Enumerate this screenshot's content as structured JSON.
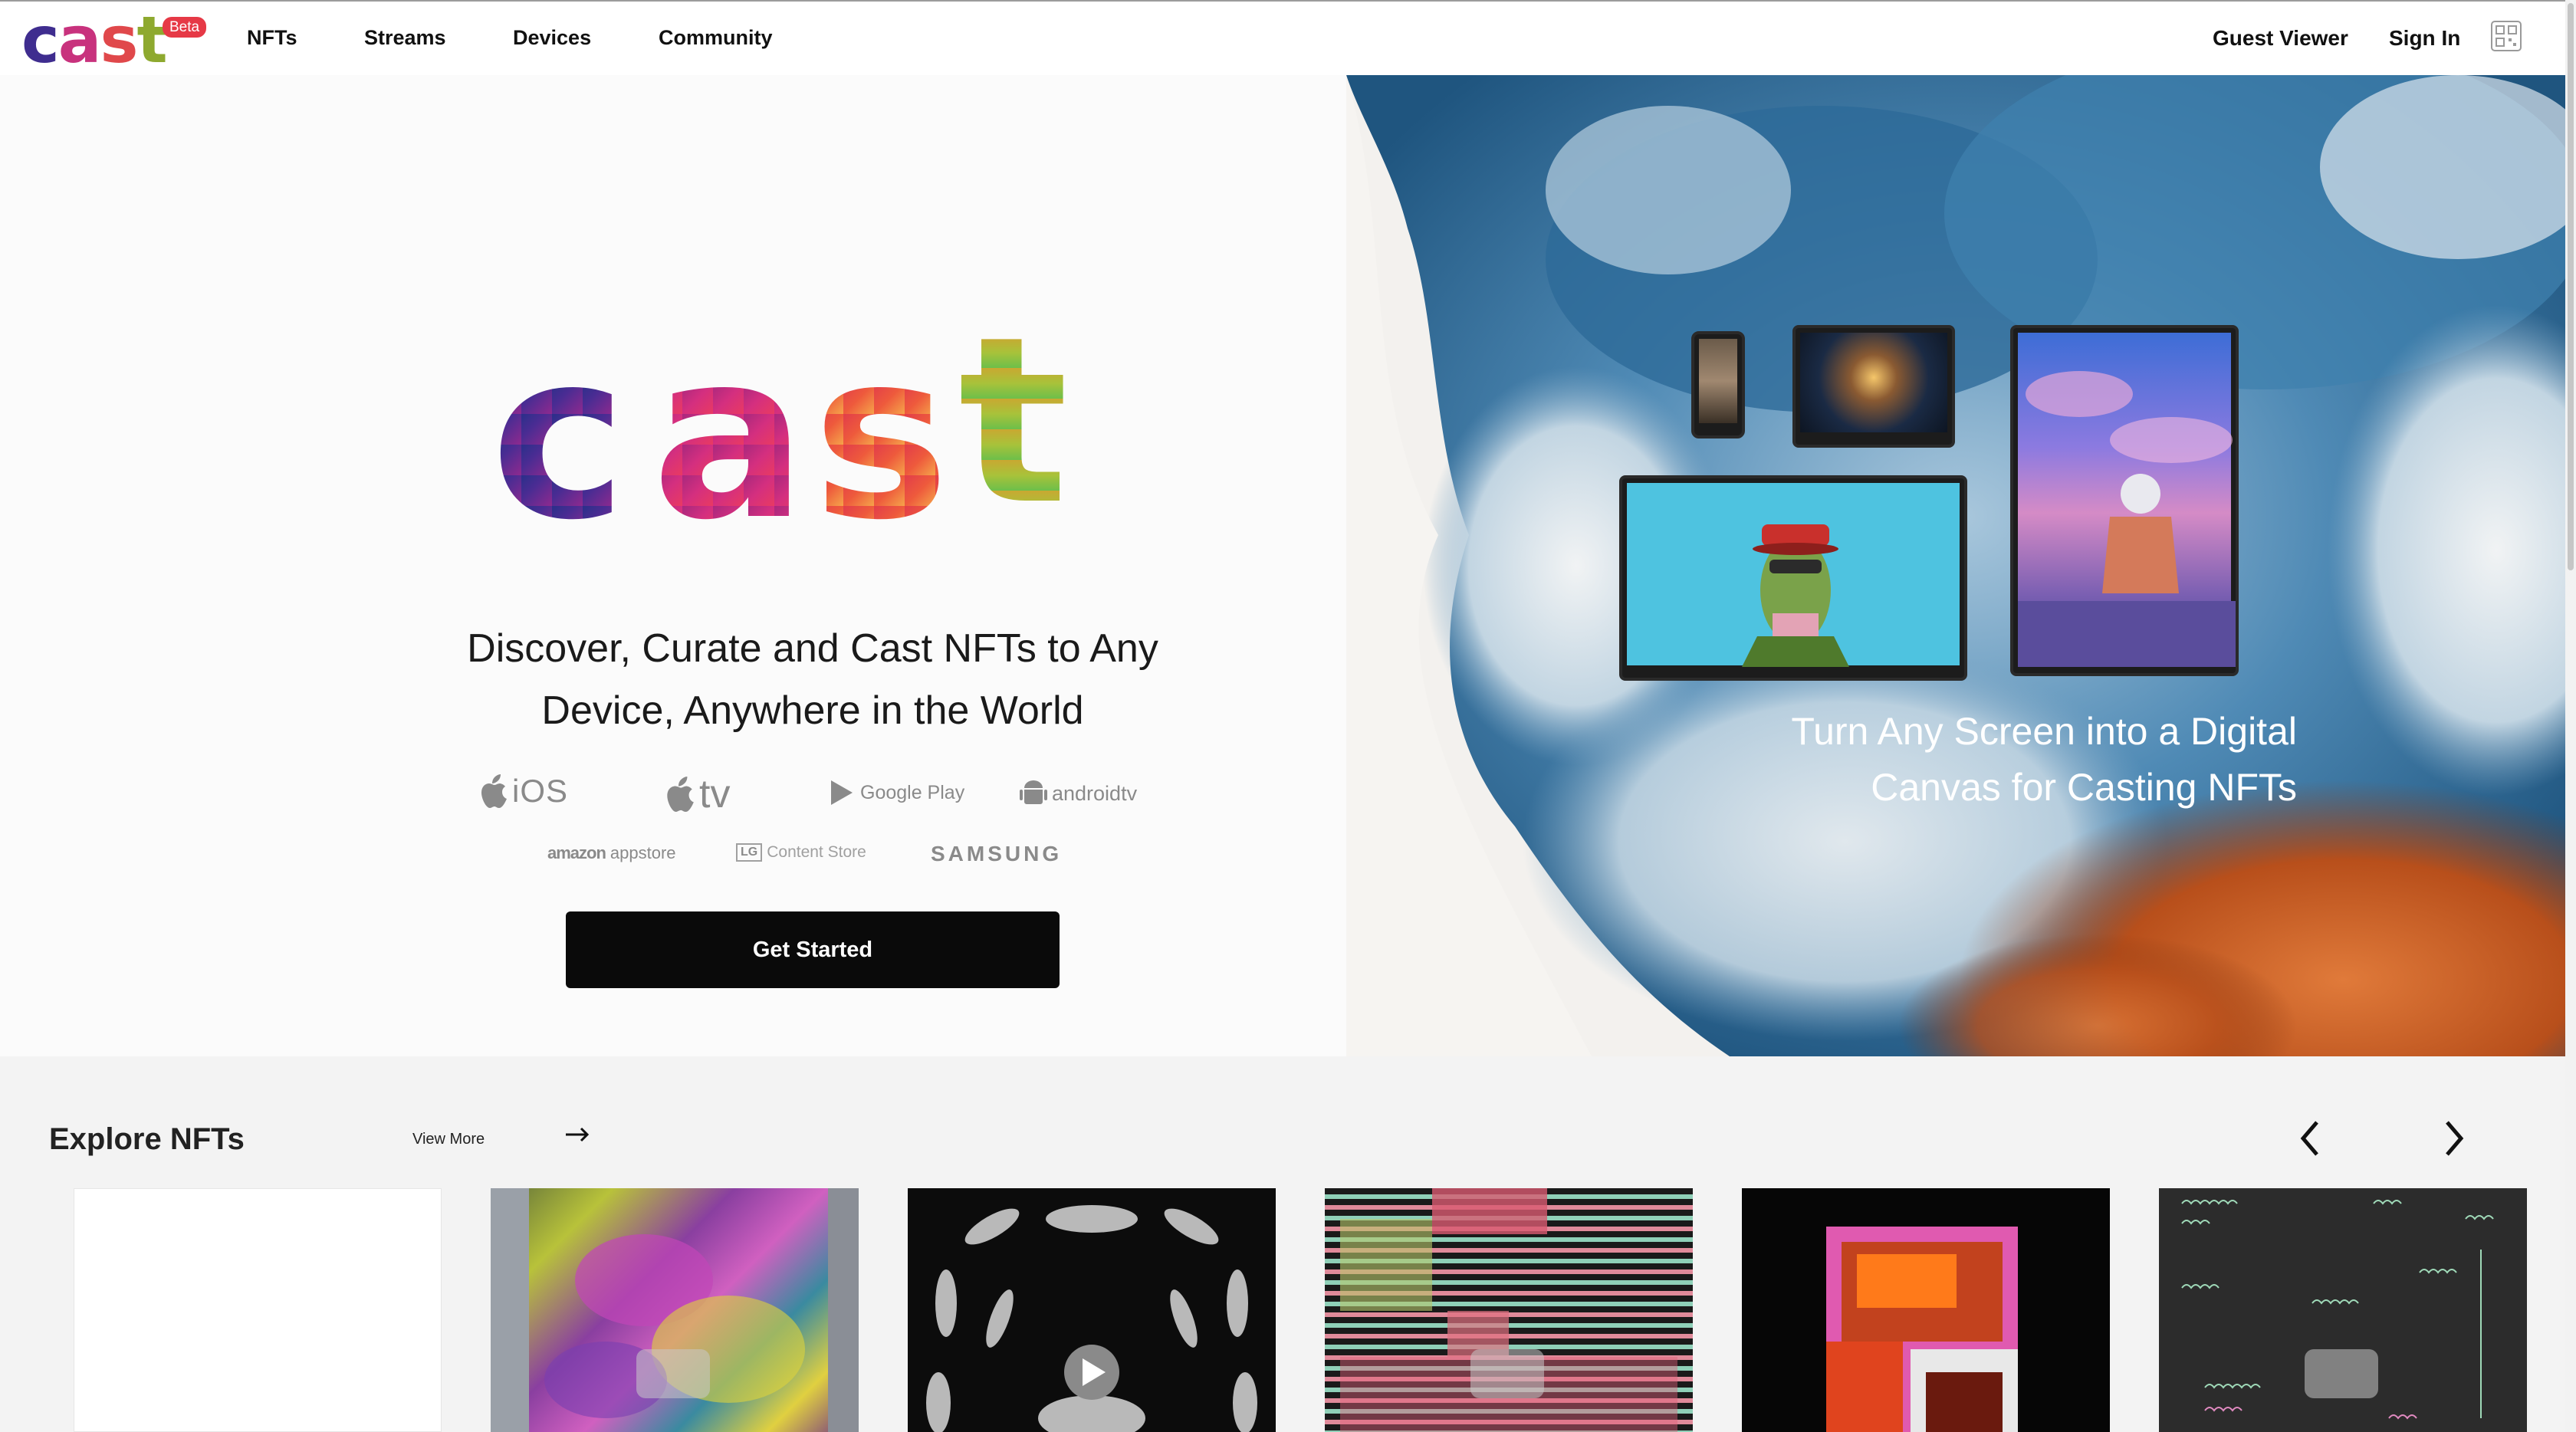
{
  "nav": {
    "logo": "cast",
    "beta": "Beta",
    "links": [
      "NFTs",
      "Streams",
      "Devices",
      "Community"
    ],
    "guest_viewer": "Guest Viewer",
    "sign_in": "Sign In",
    "qr_icon": "qr-code-icon"
  },
  "hero": {
    "logo": "cast",
    "tagline_line1": "Discover, Curate and Cast NFTs to Any",
    "tagline_line2": "Device, Anywhere in the World",
    "platforms": {
      "ios": "iOS",
      "tv": "tv",
      "google_play": "Google Play",
      "androidtv": "androidtv",
      "amazon": "amazon",
      "appstore": "appstore",
      "lg": "LG",
      "content_store": "Content Store",
      "samsung": "SAMSUNG"
    },
    "cta": "Get Started",
    "caption_line1": "Turn Any Screen into a Digital",
    "caption_line2": "Canvas for Casting NFTs",
    "device_brand": "cast"
  },
  "explore": {
    "title": "Explore NFTs",
    "view_more": "View More",
    "prev_icon": "chevron-left-icon",
    "next_icon": "chevron-right-icon",
    "cards": [
      {
        "name": "blank"
      },
      {
        "name": "colorful-fur"
      },
      {
        "name": "silver-ovals"
      },
      {
        "name": "stripes-xo"
      },
      {
        "name": "orange-doorway"
      },
      {
        "name": "ascii-pattern"
      }
    ]
  },
  "colors": {
    "accent_beta": "#e63946",
    "cta_bg": "#0a0a0a",
    "smoke_blue": "#3d7ca8",
    "smoke_orange": "#c4581e"
  }
}
